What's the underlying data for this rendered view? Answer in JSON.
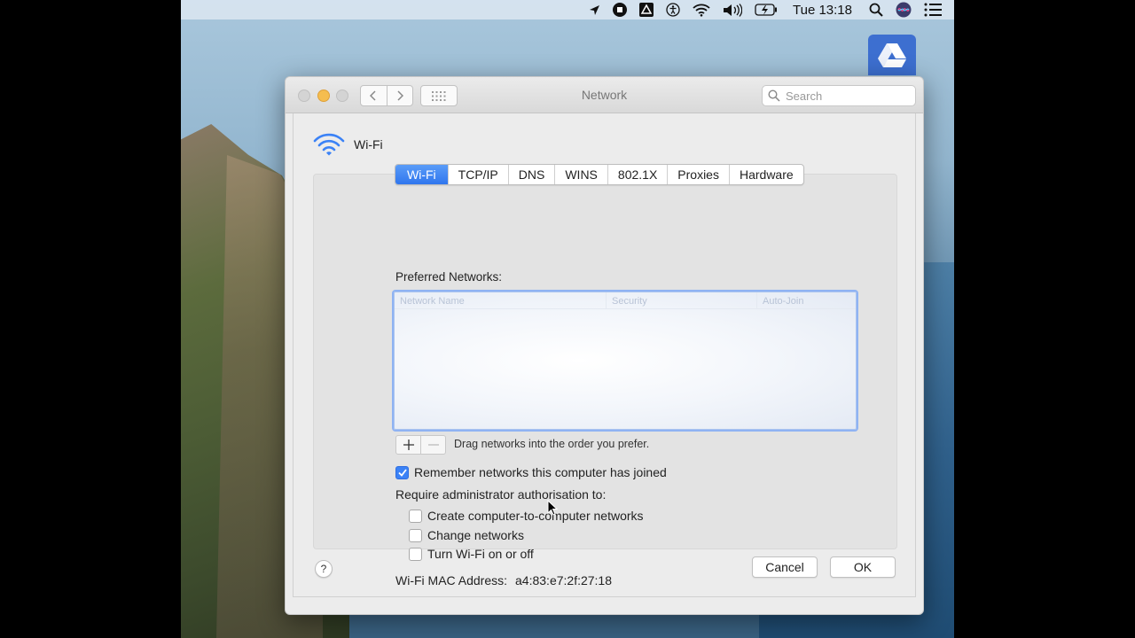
{
  "menubar": {
    "icons": [
      "location-arrow-icon",
      "stop-recording-icon",
      "google-drive-icon",
      "accessibility-icon",
      "wifi-icon",
      "volume-icon",
      "battery-icon",
      "spotlight-search-icon",
      "siri-icon",
      "notification-center-icon"
    ],
    "clock": "Tue 13:18"
  },
  "window": {
    "title": "Network",
    "search_placeholder": "Search"
  },
  "sheet": {
    "interface_name": "Wi-Fi",
    "tabs": [
      {
        "label": "Wi-Fi",
        "active": true
      },
      {
        "label": "TCP/IP"
      },
      {
        "label": "DNS"
      },
      {
        "label": "WINS"
      },
      {
        "label": "802.1X"
      },
      {
        "label": "Proxies"
      },
      {
        "label": "Hardware"
      }
    ],
    "preferred_label": "Preferred Networks:",
    "table_columns": [
      "Network Name",
      "Security",
      "Auto-Join"
    ],
    "drag_hint": "Drag networks into the order you prefer.",
    "remember_label": "Remember networks this computer has joined",
    "remember_checked": true,
    "require_label": "Require administrator authorisation to:",
    "options": [
      {
        "label": "Create computer-to-computer networks",
        "checked": false
      },
      {
        "label": "Change networks",
        "checked": false
      },
      {
        "label": "Turn Wi-Fi on or off",
        "checked": false
      }
    ],
    "mac_label": "Wi-Fi MAC Address:",
    "mac_value": "a4:83:e7:2f:27:18",
    "help": "?",
    "cancel": "Cancel",
    "ok": "OK"
  },
  "colors": {
    "accent": "#2f76ee",
    "min_light": "#f5bd4f",
    "drive_icon": "#3d6fd0"
  }
}
